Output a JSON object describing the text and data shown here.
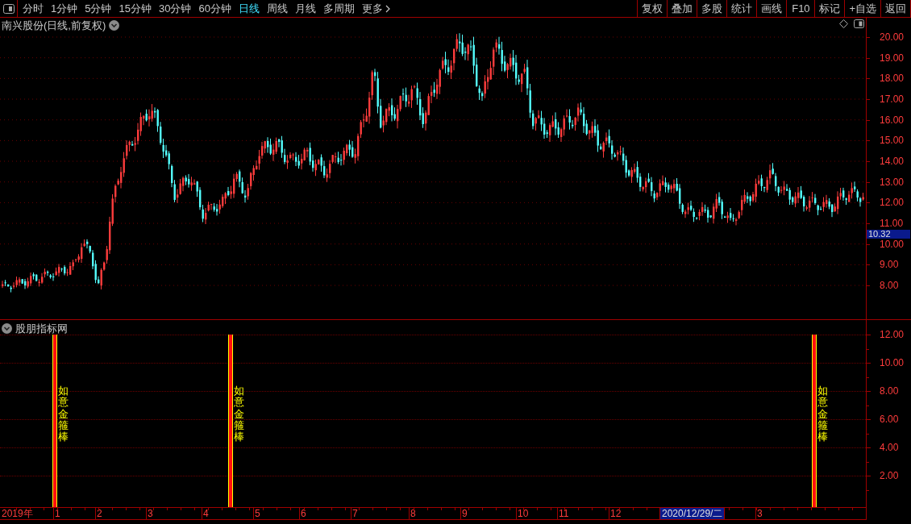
{
  "toolbar": {
    "periods": [
      {
        "label": "分时",
        "selected": false
      },
      {
        "label": "1分钟",
        "selected": false
      },
      {
        "label": "5分钟",
        "selected": false
      },
      {
        "label": "15分钟",
        "selected": false
      },
      {
        "label": "30分钟",
        "selected": false
      },
      {
        "label": "60分钟",
        "selected": false
      },
      {
        "label": "日线",
        "selected": true
      },
      {
        "label": "周线",
        "selected": false
      },
      {
        "label": "月线",
        "selected": false
      },
      {
        "label": "多周期",
        "selected": false
      }
    ],
    "more": "更多",
    "actions": [
      "复权",
      "叠加",
      "多股",
      "统计",
      "画线",
      "F10",
      "标记",
      "+自选",
      "返回"
    ]
  },
  "main_panel": {
    "title": "南兴股份(日线,前复权)",
    "price_axis": [
      "20.00",
      "19.00",
      "18.00",
      "17.00",
      "16.00",
      "15.00",
      "14.00",
      "13.00",
      "12.00",
      "11.00",
      "10.00",
      "9.00",
      "8.00"
    ],
    "current_price": "10.32"
  },
  "indicator_panel": {
    "title": "股朋指标网",
    "axis": [
      "12.00",
      "10.00",
      "8.00",
      "6.00",
      "4.00",
      "2.00"
    ],
    "signals": [
      {
        "label": "如意金箍棒"
      },
      {
        "label": "如意金箍棒"
      },
      {
        "label": "如意金箍棒"
      }
    ]
  },
  "time_axis": {
    "labels": [
      "2019年",
      "1",
      "2",
      "3",
      "4",
      "5",
      "6",
      "7",
      "8",
      "9",
      "10",
      "11",
      "12",
      "3"
    ],
    "cursor_date": "2020/12/29/二"
  }
}
